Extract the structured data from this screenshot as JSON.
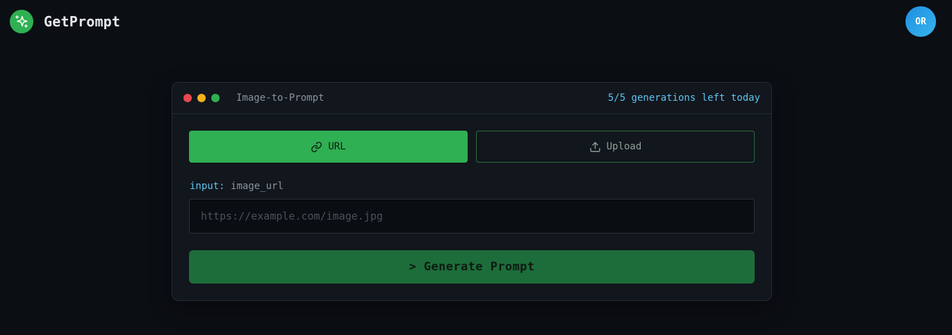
{
  "header": {
    "brand": "GetPrompt",
    "logo_icon": "sparkles-icon",
    "avatar_initials": "OR"
  },
  "card": {
    "title": "Image-to-Prompt",
    "generations_left": "5/5 generations left today",
    "window_dots": [
      "red",
      "yellow",
      "green"
    ],
    "tabs": [
      {
        "label": "URL",
        "icon": "link-icon",
        "active": true
      },
      {
        "label": "Upload",
        "icon": "upload-icon",
        "active": false
      }
    ],
    "input": {
      "label_key": "input:",
      "label_name": "image_url",
      "value": "",
      "placeholder": "https://example.com/image.jpg"
    },
    "generate_label": "> Generate Prompt"
  },
  "colors": {
    "background": "#0b0e13",
    "card": "#12161d",
    "accent_green": "#2fb052",
    "button_green": "#1d6d3a",
    "info_blue": "#5ec3f0",
    "avatar_blue": "#2a9fe8"
  }
}
